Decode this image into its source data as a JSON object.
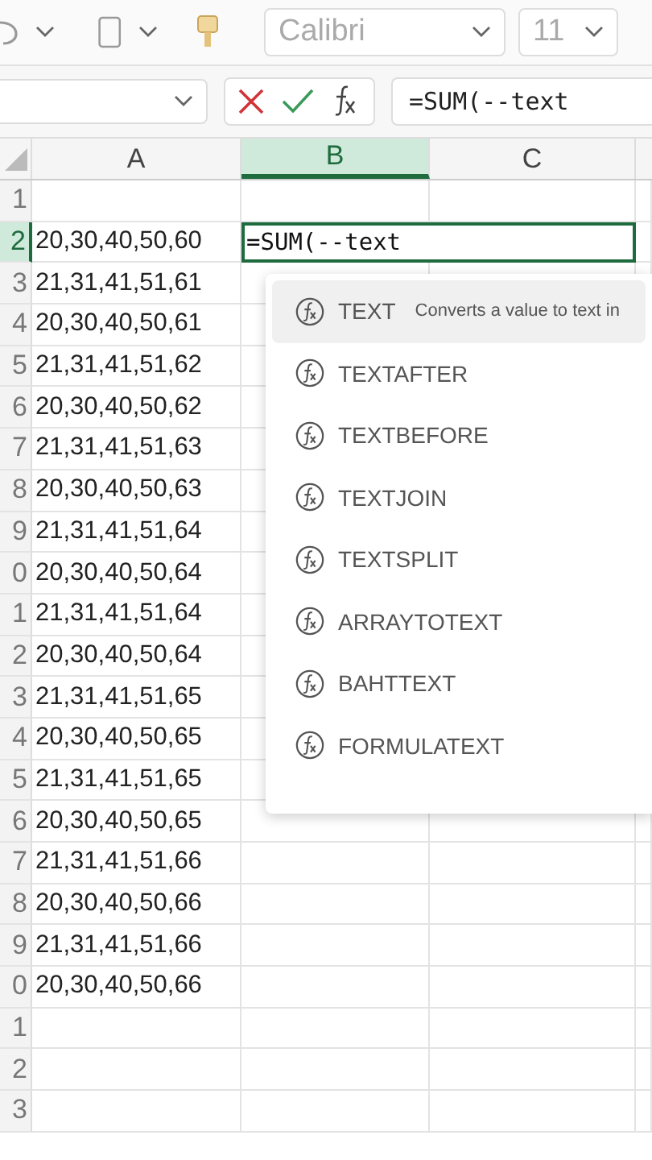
{
  "toolbar": {
    "font": "Calibri",
    "font_size": "11"
  },
  "formula_bar": {
    "formula": "=SUM(--text"
  },
  "columns": [
    {
      "label": "A",
      "selected": false
    },
    {
      "label": "B",
      "selected": true
    },
    {
      "label": "C",
      "selected": false
    }
  ],
  "rows": [
    {
      "header": "1",
      "selected": false
    },
    {
      "header": "2",
      "selected": true,
      "value_a": "20,30,40,50,60",
      "edit_text": "=SUM(--text"
    },
    {
      "header": "3",
      "selected": false,
      "value_a": "21,31,41,51,61"
    },
    {
      "header": "4",
      "selected": false,
      "value_a": "20,30,40,50,61"
    },
    {
      "header": "5",
      "selected": false,
      "value_a": "21,31,41,51,62"
    },
    {
      "header": "6",
      "selected": false,
      "value_a": "20,30,40,50,62"
    },
    {
      "header": "7",
      "selected": false,
      "value_a": "21,31,41,51,63"
    },
    {
      "header": "8",
      "selected": false,
      "value_a": "20,30,40,50,63"
    },
    {
      "header": "9",
      "selected": false,
      "value_a": "21,31,41,51,64"
    },
    {
      "header": "0",
      "selected": false,
      "value_a": "20,30,40,50,64"
    },
    {
      "header": "1",
      "selected": false,
      "value_a": "21,31,41,51,64"
    },
    {
      "header": "2",
      "selected": false,
      "value_a": "20,30,40,50,64"
    },
    {
      "header": "3",
      "selected": false,
      "value_a": "21,31,41,51,65"
    },
    {
      "header": "4",
      "selected": false,
      "value_a": "20,30,40,50,65"
    },
    {
      "header": "5",
      "selected": false,
      "value_a": "21,31,41,51,65"
    },
    {
      "header": "6",
      "selected": false,
      "value_a": "20,30,40,50,65"
    },
    {
      "header": "7",
      "selected": false,
      "value_a": "21,31,41,51,66"
    },
    {
      "header": "8",
      "selected": false,
      "value_a": "20,30,40,50,66"
    },
    {
      "header": "9",
      "selected": false,
      "value_a": "21,31,41,51,66"
    },
    {
      "header": "0",
      "selected": false,
      "value_a": "20,30,40,50,66"
    },
    {
      "header": "1",
      "selected": false
    },
    {
      "header": "2",
      "selected": false
    },
    {
      "header": "3",
      "selected": false
    }
  ],
  "autocomplete": {
    "items": [
      {
        "name": "TEXT",
        "description": "Converts a value to text in",
        "selected": true
      },
      {
        "name": "TEXTAFTER",
        "selected": false
      },
      {
        "name": "TEXTBEFORE",
        "selected": false
      },
      {
        "name": "TEXTJOIN",
        "selected": false
      },
      {
        "name": "TEXTSPLIT",
        "selected": false
      },
      {
        "name": "ARRAYTOTEXT",
        "selected": false
      },
      {
        "name": "BAHTTEXT",
        "selected": false
      },
      {
        "name": "FORMULATEXT",
        "selected": false
      }
    ]
  }
}
